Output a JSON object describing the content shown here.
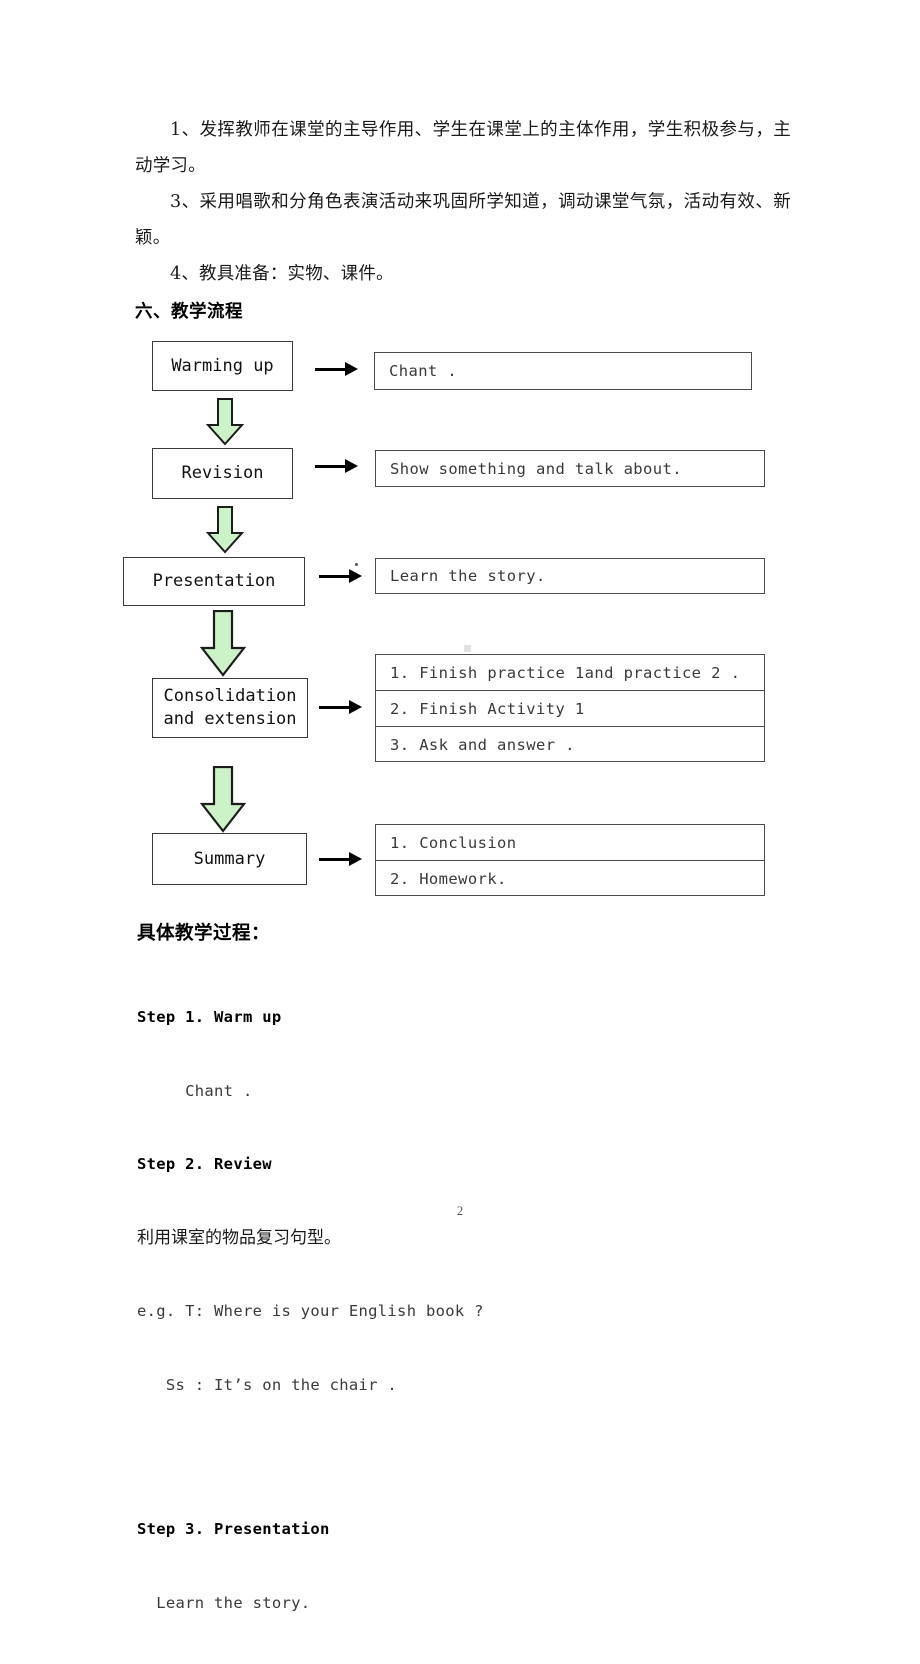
{
  "document": {
    "page_number": "2",
    "body_paragraphs": [
      "1、发挥教师在课堂的主导作用、学生在课堂上的主体作用，学生积极参与，主动学习。",
      "3、采用唱歌和分角色表演活动来巩固所学知道，调动课堂气氛，活动有效、新颖。",
      "4、教具准备：实物、课件。"
    ],
    "section_heading": "六、教学流程",
    "sub_heading": "具体教学过程："
  },
  "flowchart": {
    "arrow_color_fill": "#ccf2c8",
    "arrow_color_stroke": "#1c1c1c",
    "stages": [
      {
        "node": "Warming up",
        "node_line2": "",
        "details": [
          "Chant ."
        ]
      },
      {
        "node": "Revision",
        "node_line2": "",
        "details": [
          "Show something and talk about."
        ]
      },
      {
        "node": "Presentation",
        "node_line2": "",
        "details": [
          "Learn the story."
        ]
      },
      {
        "node": "Consolidation",
        "node_line2": "and extension",
        "details": [
          "1. Finish practice 1and practice 2 .",
          "2. Finish Activity 1",
          "3. Ask and answer ."
        ]
      },
      {
        "node": "Summary",
        "node_line2": "",
        "details": [
          "1. Conclusion",
          "2. Homework."
        ]
      }
    ]
  },
  "steps": {
    "lines": [
      "Step 1. Warm up",
      "     Chant .",
      "Step 2. Review",
      "利用课室的物品复习句型。",
      "e.g. T: Where is your English book ?",
      "   Ss : It’s on the chair .",
      "Step 3. Presentation",
      "  Learn the story."
    ]
  }
}
